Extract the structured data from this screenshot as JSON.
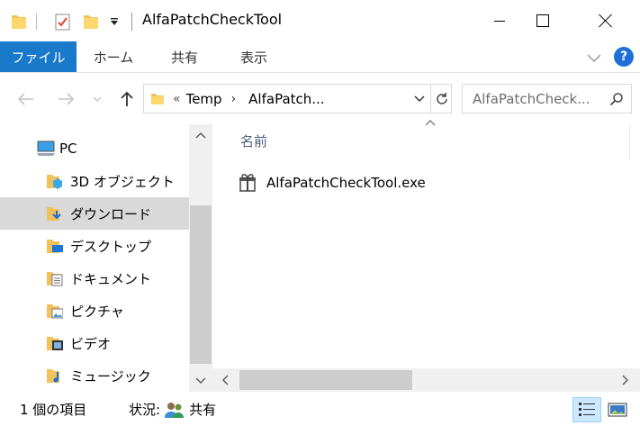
{
  "window": {
    "title": "AlfaPatchCheckTool",
    "minimize_icon": "minimize-icon",
    "maximize_icon": "maximize-icon",
    "close_icon": "close-icon"
  },
  "ribbon": {
    "tabs": [
      {
        "label": "ファイル"
      },
      {
        "label": "ホーム"
      },
      {
        "label": "共有"
      },
      {
        "label": "表示"
      }
    ],
    "help_label": "?",
    "accent": "#1979ca"
  },
  "address": {
    "overflow": "«",
    "segments": [
      "Temp",
      "AlfaPatch..."
    ],
    "separator": "›"
  },
  "search": {
    "placeholder": "AlfaPatchCheck..."
  },
  "sidebar": {
    "items": [
      {
        "label": "PC",
        "icon": "pc-icon"
      },
      {
        "label": "3D オブジェクト",
        "icon": "3d-objects-icon"
      },
      {
        "label": "ダウンロード",
        "icon": "downloads-icon",
        "selected": true
      },
      {
        "label": "デスクトップ",
        "icon": "desktop-icon"
      },
      {
        "label": "ドキュメント",
        "icon": "documents-icon"
      },
      {
        "label": "ピクチャ",
        "icon": "pictures-icon"
      },
      {
        "label": "ビデオ",
        "icon": "videos-icon"
      },
      {
        "label": "ミュージック",
        "icon": "music-icon"
      }
    ]
  },
  "main": {
    "column_header": "名前",
    "files": [
      {
        "name": "AlfaPatchCheckTool.exe",
        "icon": "exe-file-icon"
      }
    ]
  },
  "status": {
    "count": "1 個の項目",
    "state_label": "状況:",
    "state_value": "共有"
  }
}
